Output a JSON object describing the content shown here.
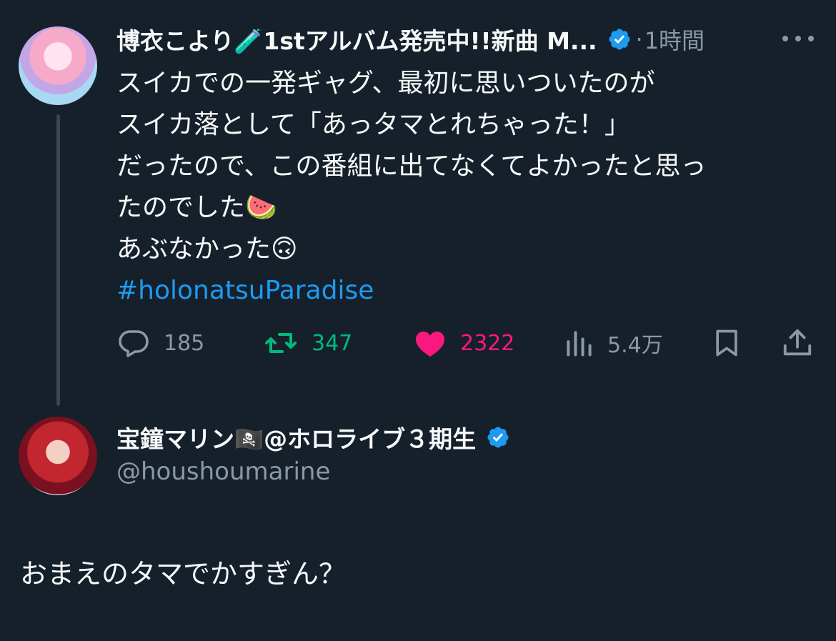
{
  "parent_tweet": {
    "display_name": "博衣こより🧪1stアルバム発売中!!新曲 M...",
    "separator": "·",
    "timestamp": "1時間",
    "body_lines": [
      "スイカでの一発ギャグ、最初に思いついたのが",
      "スイカ落として「あっタマとれちゃった！」",
      "だったので、この番組に出てなくてよかったと思っ",
      "たのでした🍉",
      "あぶなかった🙃"
    ],
    "hashtag": "#holonatsuParadise",
    "actions": {
      "replies": "185",
      "retweets": "347",
      "likes": "2322",
      "views": "5.4万"
    },
    "icons": {
      "reply": "comment-icon",
      "retweet": "retweet-icon",
      "like": "heart-icon",
      "views": "bar-chart-icon",
      "bookmark": "bookmark-icon",
      "share": "share-icon",
      "more": "more-horizontal-icon",
      "verified": "verified-badge-icon"
    }
  },
  "reply_tweet": {
    "display_name": "宝鐘マリン🏴‍☠️@ホロライブ３期生",
    "handle": "@houshoumarine",
    "text": "おまえのタマでかすぎん？"
  },
  "colors": {
    "background": "#15202b",
    "text": "#f7f9f9",
    "muted": "#8b98a5",
    "accent": "#1d9bf0",
    "retweet": "#00ba7c",
    "like": "#f91880"
  }
}
